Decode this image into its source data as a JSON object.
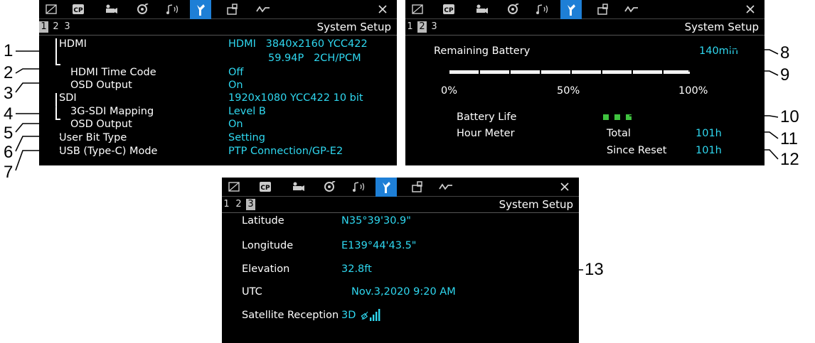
{
  "tabs": [
    "screen-icon",
    "custom-picture-icon",
    "camera-icon",
    "tone-icon",
    "audio-icon",
    "system-setup-icon",
    "assign-icon",
    "waveform-icon"
  ],
  "screen1": {
    "pages": [
      "1",
      "2",
      "3"
    ],
    "title": "System Setup",
    "rows": [
      {
        "label": "HDMI",
        "value": "HDMI   3840x2160 YCC422"
      },
      {
        "label": "",
        "value": "59.94P   2CH/PCM"
      },
      {
        "label": "HDMI Time Code",
        "value": "Off"
      },
      {
        "label": "OSD Output",
        "value": "On"
      },
      {
        "label": "SDI",
        "value": "1920x1080 YCC422 10 bit"
      },
      {
        "label": "3G-SDI Mapping",
        "value": "Level B"
      },
      {
        "label": "OSD Output",
        "value": "On"
      },
      {
        "label": "User Bit Type",
        "value": "Setting"
      },
      {
        "label": "USB (Type-C) Mode",
        "value": "PTP Connection/GP-E2"
      }
    ]
  },
  "screen2": {
    "pages": [
      "1",
      "2",
      "3"
    ],
    "title": "System Setup",
    "remaining_label": "Remaining Battery",
    "remaining_value": "140min",
    "battery_fraction": 1.0,
    "scale": [
      "0%",
      "50%",
      "100%"
    ],
    "battery_life_label": "Battery Life",
    "battery_life_level": 3,
    "hour_meter_label": "Hour Meter",
    "total_label": "Total",
    "total_value": "101h",
    "since_reset_label": "Since Reset",
    "since_reset_value": "101h"
  },
  "screen3": {
    "pages": [
      "1",
      "2",
      "3"
    ],
    "title": "System Setup",
    "rows": [
      {
        "label": "Latitude",
        "value": "N35°39'30.9\""
      },
      {
        "label": "Longitude",
        "value": "E139°44'43.5\""
      },
      {
        "label": "Elevation",
        "value": "32.8ft"
      },
      {
        "label": "UTC",
        "value": "Nov.3,2020 9:20 AM"
      },
      {
        "label": "Satellite Reception",
        "value": "3D"
      }
    ]
  },
  "callouts": [
    "1",
    "2",
    "3",
    "4",
    "5",
    "6",
    "7",
    "8",
    "9",
    "10",
    "11",
    "12",
    "13"
  ],
  "colors": {
    "accent": "#1e7fd6",
    "value": "#2fd8f0",
    "battery_green": "#3fc23f"
  }
}
